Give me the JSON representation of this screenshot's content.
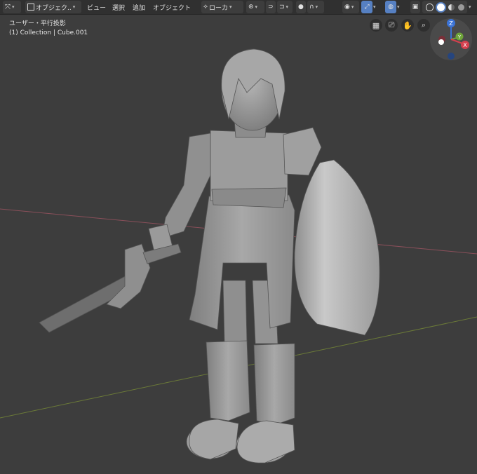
{
  "header": {
    "editor_type_icon": "viewport-3d-icon",
    "mode_label": "オブジェク..",
    "menu": {
      "view": "ビュー",
      "select": "選択",
      "add": "追加",
      "object": "オブジェクト"
    },
    "transform_orientation": "ローカ",
    "right_icons": [
      "visibility-icon",
      "gizmo-toggle-icon",
      "overlay-icon",
      "xray-icon",
      "shading-wireframe-icon",
      "shading-solid-icon",
      "shading-material-icon",
      "shading-rendered-icon"
    ]
  },
  "viewport": {
    "view_title": "ユーザー・平行投影",
    "object_info": "(1) Collection | Cube.001",
    "nav_icons": [
      "grid-icon",
      "camera-icon",
      "hand-icon",
      "zoom-icon"
    ],
    "gizmo": {
      "z": "Z",
      "y": "Y",
      "x": "X"
    },
    "colors": {
      "background": "#3d3d3d",
      "x_axis": "#8a4f5a",
      "y_axis": "#6b7a38",
      "model": "#9a9a9a"
    }
  }
}
